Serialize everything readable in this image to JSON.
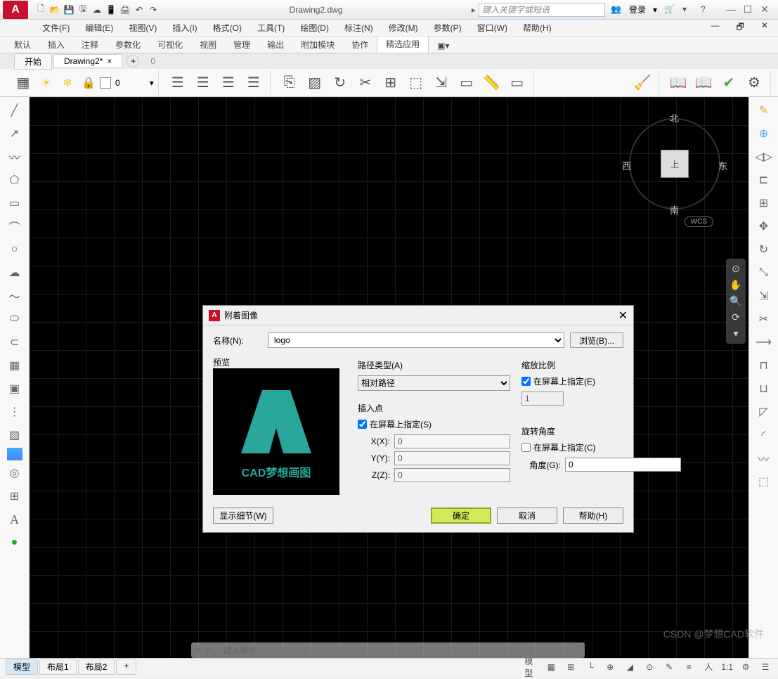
{
  "title": "Drawing2.dwg",
  "search_placeholder": "键入关键字或短语",
  "login": "登录",
  "menus": [
    "文件(F)",
    "编辑(E)",
    "视图(V)",
    "插入(I)",
    "格式(O)",
    "工具(T)",
    "绘图(D)",
    "标注(N)",
    "修改(M)",
    "参数(P)",
    "窗口(W)",
    "帮助(H)"
  ],
  "ribbon_tabs": [
    "默认",
    "插入",
    "注释",
    "参数化",
    "可视化",
    "视图",
    "管理",
    "输出",
    "附加模块",
    "协作",
    "精选应用"
  ],
  "file_tabs": {
    "start": "开始",
    "drawing": "Drawing2*",
    "count": "0"
  },
  "compass": {
    "n": "北",
    "s": "南",
    "e": "东",
    "w": "西",
    "top": "上",
    "wcs": "WCS"
  },
  "cmd_placeholder": "键入命令",
  "dialog": {
    "title": "附着图像",
    "name_lbl": "名称(N):",
    "name_val": "logo",
    "browse": "浏览(B)...",
    "preview": "预览",
    "preview_text": "CAD梦想画图",
    "path_type": "路径类型(A)",
    "path_val": "相对路径",
    "insert": "插入点",
    "specify_screen_s": "在屏幕上指定(S)",
    "x": "X(X):",
    "y": "Y(Y):",
    "z": "Z(Z):",
    "xv": "0",
    "yv": "0",
    "zv": "0",
    "scale": "缩放比例",
    "specify_screen_e": "在屏幕上指定(E)",
    "scale_val": "1",
    "rotation": "旋转角度",
    "specify_screen_c": "在屏幕上指定(C)",
    "angle": "角度(G):",
    "angle_val": "0",
    "detail": "显示细节(W)",
    "ok": "确定",
    "cancel": "取消",
    "help": "帮助(H)"
  },
  "status": {
    "model": "模型",
    "layout1": "布局1",
    "layout2": "布局2",
    "model_btn": "模型",
    "scale": "1:1"
  },
  "watermark": "CSDN @梦想CAD软件"
}
